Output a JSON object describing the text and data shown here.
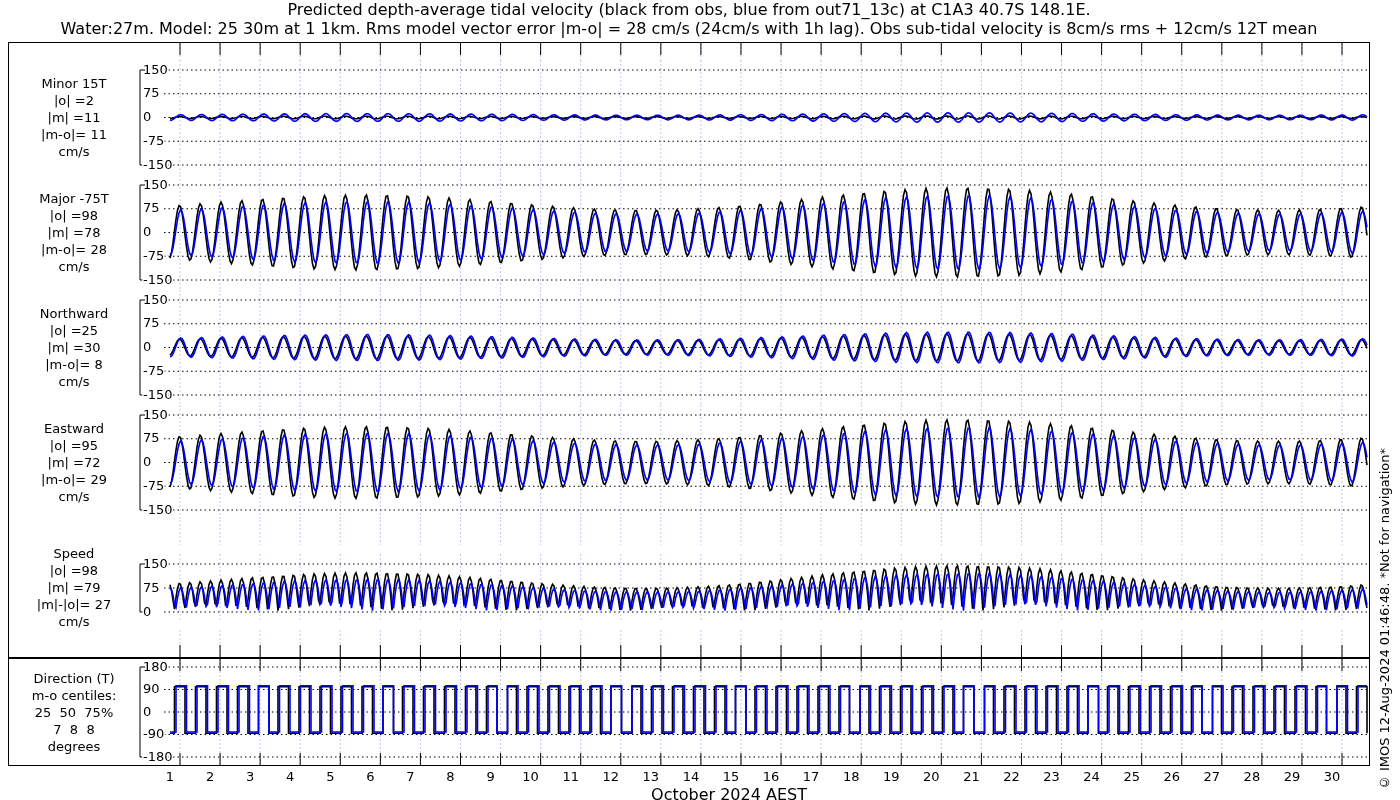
{
  "title": {
    "lines": [
      "Predicted depth-average tidal velocity (black from obs, blue from out71_13c) at C1A3 40.7S 148.1E.",
      "Water:27m. Model: 25 30m at 1 1km. Rms model vector error |m-o| = 28 cm/s (24cm/s with 1h lag). Obs sub-tidal velocity is 8cm/s rms + 12cm/s 12T mean"
    ]
  },
  "panels": [
    {
      "kind": "signed",
      "label": [
        "Minor 15T",
        "|o| =2",
        "|m| =11",
        "|m-o|= 11",
        "cm/s"
      ],
      "yticks": [
        "150",
        "75",
        "0",
        "-75",
        "-150"
      ]
    },
    {
      "kind": "signed",
      "label": [
        "Major -75T",
        "|o| =98",
        "|m| =78",
        "|m-o|= 28",
        "cm/s"
      ],
      "yticks": [
        "150",
        "75",
        "0",
        "-75",
        "-150"
      ]
    },
    {
      "kind": "signed",
      "label": [
        "Northward",
        "|o| =25",
        "|m| =30",
        "|m-o|= 8",
        "cm/s"
      ],
      "yticks": [
        "150",
        "75",
        "0",
        "-75",
        "-150"
      ]
    },
    {
      "kind": "signed",
      "label": [
        "Eastward",
        "|o| =95",
        "|m| =72",
        "|m-o|= 29",
        "cm/s"
      ],
      "yticks": [
        "150",
        "75",
        "0",
        "-75",
        "-150"
      ]
    },
    {
      "kind": "speed",
      "label": [
        "Speed",
        "|o| =98",
        "|m| =79",
        "|m|-|o|= 27",
        "cm/s"
      ],
      "yticks": [
        "150",
        "75",
        "0"
      ]
    },
    {
      "kind": "direction",
      "label": [
        "Direction (T)",
        "m-o centiles:",
        "25  50  75%",
        "7  8  8",
        "degrees"
      ],
      "yticks": [
        "180",
        "90",
        "0",
        "-90",
        "-180"
      ]
    }
  ],
  "x_axis": {
    "ticks": [
      "1",
      "2",
      "3",
      "4",
      "5",
      "6",
      "7",
      "8",
      "9",
      "10",
      "11",
      "12",
      "13",
      "14",
      "15",
      "16",
      "17",
      "18",
      "19",
      "20",
      "21",
      "22",
      "23",
      "24",
      "25",
      "26",
      "27",
      "28",
      "29",
      "30"
    ],
    "title": "October 2024 AEST"
  },
  "credit": "© IMOS 12-Aug-2024 01:46:48. *Not for navigation*"
}
